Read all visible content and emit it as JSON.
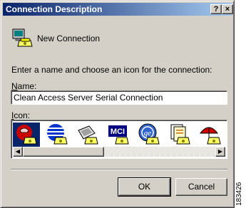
{
  "dialog": {
    "title": "Connection Description",
    "help_label": "?",
    "close_label": "×",
    "new_connection_label": "New Connection",
    "prompt": "Enter a name and choose an icon for the connection:",
    "name_label_first": "N",
    "name_label_rest": "ame:",
    "name_value": "Clean Access Server Serial Connection",
    "icon_label_first": "I",
    "icon_label_rest": "con:",
    "icons": [
      {
        "name": "red-phone-icon",
        "selected": true
      },
      {
        "name": "globe-modem-icon",
        "selected": false
      },
      {
        "name": "phone-handset-icon",
        "selected": false
      },
      {
        "name": "mci-icon",
        "selected": false
      },
      {
        "name": "ge-icon",
        "selected": false
      },
      {
        "name": "documents-icon",
        "selected": false
      },
      {
        "name": "umbrella-icon",
        "selected": false
      }
    ],
    "ok_label": "OK",
    "cancel_label": "Cancel"
  },
  "figure_number": "183426",
  "colors": {
    "titlebar_start": "#0a246a",
    "titlebar_end": "#a6caf0",
    "face": "#d4d0c8"
  }
}
